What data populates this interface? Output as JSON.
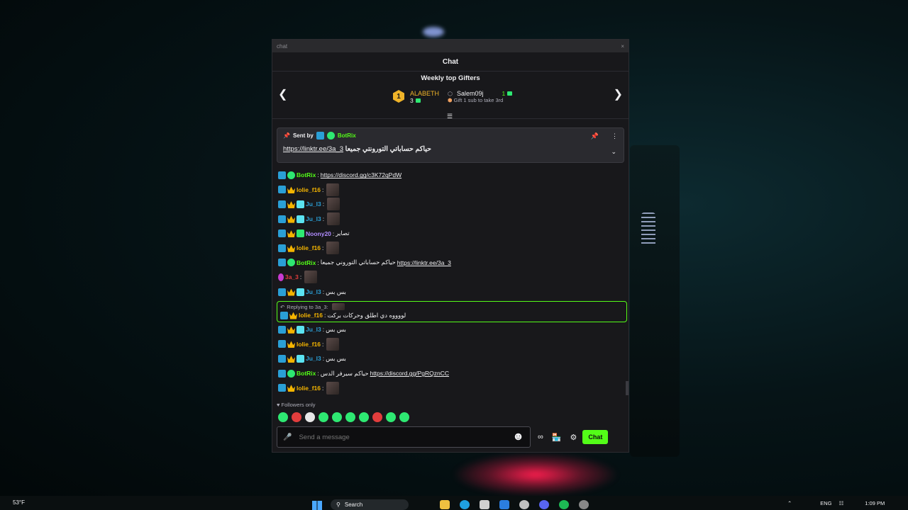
{
  "window": {
    "title": "chat",
    "close": "×"
  },
  "header": {
    "title": "Chat"
  },
  "gifters": {
    "title": "Weekly top Gifters",
    "first": {
      "rank": "1",
      "name": "ALABETH",
      "count": "3"
    },
    "second": {
      "name": "Salem09j",
      "count": "1",
      "hint": "Gift 1 sub to take 3rd"
    }
  },
  "pinned": {
    "sent_by": "Sent by",
    "user": "BotRix",
    "link": "https://linktr.ee/3a_3",
    "text": "حياكم حساباتي التورونتي جميعا"
  },
  "messages": [
    {
      "user": "BotRix",
      "sep": ":",
      "text": "",
      "link": "https://discord.gg/c3K72qPdW",
      "color": "#53fc18"
    },
    {
      "user": "lolie_f16",
      "sep": ":",
      "text": "",
      "link": "",
      "color": "#f4b400"
    },
    {
      "user": "Ju_l3",
      "sep": ":",
      "text": "",
      "link": "",
      "color": "#2a9fd6"
    },
    {
      "user": "Ju_l3",
      "sep": ":",
      "text": "",
      "link": "",
      "color": "#2a9fd6"
    },
    {
      "user": "Noony20",
      "sep": ":",
      "text": "تصاير",
      "link": "",
      "color": "#b18cff"
    },
    {
      "user": "lolie_f16",
      "sep": ":",
      "text": "",
      "link": "",
      "color": "#f4b400"
    },
    {
      "user": "BotRix",
      "sep": ":",
      "text": "حياكم حساباتي التوروني جميعا",
      "link": "https://linktr.ee/3a_3",
      "color": "#53fc18"
    },
    {
      "user": "3a_3",
      "sep": ":",
      "text": "",
      "link": "",
      "color": "#e23d3d"
    },
    {
      "user": "Ju_l3",
      "sep": ":",
      "text": "بس بس",
      "link": "",
      "color": "#2a9fd6"
    }
  ],
  "reply": {
    "head": "Replying to 3a_3:",
    "user": "lolie_f16",
    "sep": ":",
    "text": "لووووه دي اطلق وحركات بركت"
  },
  "messages2": [
    {
      "user": "Ju_l3",
      "sep": ":",
      "text": "بس بس",
      "link": "",
      "color": "#2a9fd6"
    },
    {
      "user": "lolie_f16",
      "sep": ":",
      "text": "",
      "link": "",
      "color": "#f4b400"
    },
    {
      "user": "Ju_l3",
      "sep": ":",
      "text": "بس بس",
      "link": "",
      "color": "#2a9fd6"
    },
    {
      "user": "BotRix",
      "sep": ":",
      "text": "حياكم سيرفر الدس",
      "link": "https://discord.gg/PgRQznCC",
      "color": "#53fc18"
    },
    {
      "user": "lolie_f16",
      "sep": ":",
      "text": "",
      "link": "",
      "color": "#f4b400"
    }
  ],
  "followers": "Followers only",
  "input": {
    "placeholder": "Send a message"
  },
  "send_button": "Chat",
  "taskbar": {
    "temp": "53°F",
    "search": "Search",
    "lang": "ENG",
    "time": "1:09 PM"
  }
}
